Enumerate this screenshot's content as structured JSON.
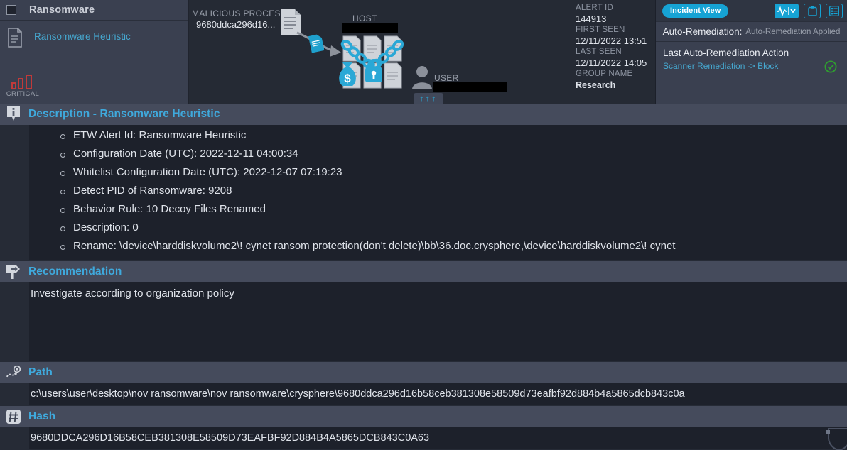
{
  "alert_card": {
    "title": "Ransomware",
    "sub_label": "Ransomware Heuristic",
    "severity_label": "CRITICAL",
    "checkbox_checked": false,
    "doc_icon": "document-icon",
    "severity_icon": "severity-bars-icon",
    "severity_color": "#c03a3a"
  },
  "graph": {
    "malicious_process_label": "MALICIOUS PROCESS",
    "malicious_process_value": "9680ddca296d16...",
    "host_label": "HOST",
    "host_value": "",
    "user_label": "USER",
    "user_value": "",
    "arrows": "↑↑↑",
    "icons": {
      "process": "document-icon",
      "dropper": "malicious-file-icon",
      "files": "encrypted-files-icon",
      "chain": "chain-icon",
      "lock": "padlock-icon",
      "money": "money-bag-icon",
      "user": "user-avatar-icon",
      "expand": "expand-up-arrows-button"
    },
    "accent": "#16a3d4"
  },
  "alert_meta": [
    {
      "key": "ALERT ID",
      "value": "144913",
      "bold": false
    },
    {
      "key": "FIRST SEEN",
      "value": "12/11/2022 13:51",
      "bold": false
    },
    {
      "key": "LAST SEEN",
      "value": "12/11/2022 14:05",
      "bold": false
    },
    {
      "key": "GROUP NAME",
      "value": "Research",
      "bold": true
    }
  ],
  "remediation": {
    "incident_view_label": "Incident View",
    "toolbar_icons": [
      "activity-chart-dropdown-icon",
      "clipboard-icon",
      "checklist-icon"
    ],
    "auto_remediation_label": "Auto-Remediation:",
    "auto_remediation_value": "Auto-Remediation Applied",
    "last_action_header": "Last Auto-Remediation Action",
    "last_action_value": "Scanner Remediation -> Block",
    "status_icon": "green-check-circle-icon",
    "status_color": "#2f9e2f"
  },
  "sections": {
    "description": {
      "icon": "info-icon",
      "title": "Description - Ransomware Heuristic",
      "items": [
        "ETW Alert Id: Ransomware Heuristic",
        "Configuration Date (UTC): 2022-12-11 04:00:34",
        "Whitelist Configuration Date (UTC): 2022-12-07 07:19:23",
        "Detect PID of Ransomware: 9208",
        "Behavior Rule: 10 Decoy Files Renamed",
        "Description: 0",
        "Rename: \\device\\harddiskvolume2\\! cynet ransom protection(don't delete)\\bb\\36.doc.crysphere,\\device\\harddiskvolume2\\! cynet"
      ]
    },
    "recommendation": {
      "icon": "signpost-icon",
      "title": "Recommendation",
      "text": "Investigate according to organization policy"
    },
    "path": {
      "icon": "path-trace-icon",
      "title": "Path",
      "value": "c:\\users\\user\\desktop\\nov ransomware\\nov ransomware\\crysphere\\9680ddca296d16b58ceb381308e58509d73eafbf92d884b4a5865dcb843c0a"
    },
    "hash": {
      "icon": "hash-icon",
      "title": "Hash",
      "value": "9680DDCA296D16B58CEB381308E58509D73EAFBF92D884B4A5865DCB843C0A63"
    }
  },
  "colors": {
    "accent_cyan": "#3fa9dc",
    "panel": "#3a4050",
    "body_dark": "#1d212b",
    "section_head": "#454b5c",
    "critical_red": "#c03a3a"
  }
}
